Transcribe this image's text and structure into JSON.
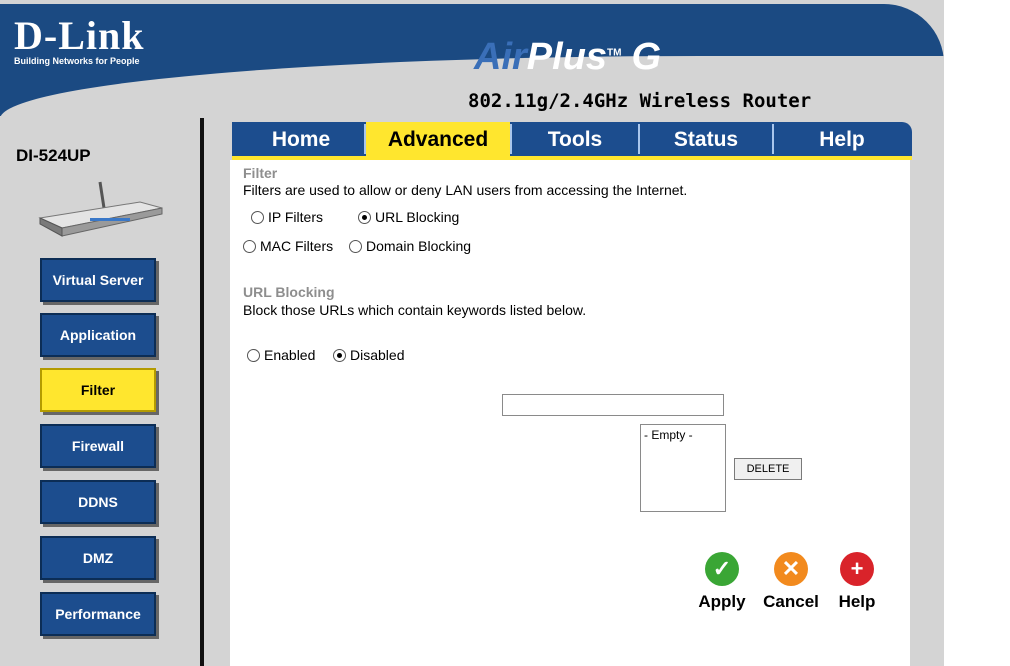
{
  "brand": {
    "logo": "D-Link",
    "tagline": "Building Networks for People",
    "product_air": "Air",
    "product_plus": "Plus",
    "product_g": "G",
    "product_tm": "TM",
    "product_line": "802.11g/2.4GHz Wireless Router"
  },
  "model": "DI-524UP",
  "tabs": [
    {
      "label": "Home",
      "active": false
    },
    {
      "label": "Advanced",
      "active": true
    },
    {
      "label": "Tools",
      "active": false
    },
    {
      "label": "Status",
      "active": false
    },
    {
      "label": "Help",
      "active": false
    }
  ],
  "sidebar": [
    {
      "label": "Virtual Server",
      "active": false
    },
    {
      "label": "Application",
      "active": false
    },
    {
      "label": "Filter",
      "active": true
    },
    {
      "label": "Firewall",
      "active": false
    },
    {
      "label": "DDNS",
      "active": false
    },
    {
      "label": "DMZ",
      "active": false
    },
    {
      "label": "Performance",
      "active": false
    }
  ],
  "filter": {
    "title": "Filter",
    "description": "Filters are used to allow or deny LAN users from accessing the Internet.",
    "options": [
      {
        "label": "IP Filters",
        "selected": false
      },
      {
        "label": "URL Blocking",
        "selected": true
      },
      {
        "label": "MAC Filters",
        "selected": false
      },
      {
        "label": "Domain Blocking",
        "selected": false
      }
    ]
  },
  "url_blocking": {
    "title": "URL Blocking",
    "description": "Block those URLs which contain keywords listed below.",
    "enabled_label": "Enabled",
    "disabled_label": "Disabled",
    "selected": "Disabled",
    "keyword_value": "",
    "list_items": [
      "- Empty -"
    ],
    "delete_label": "DELETE"
  },
  "actions": {
    "apply": "Apply",
    "cancel": "Cancel",
    "help": "Help"
  },
  "colors": {
    "brand_blue": "#1c4d8e",
    "active_yellow": "#ffe62e",
    "apply_green": "#3aa635",
    "cancel_orange": "#f28a1e",
    "help_red": "#d9232a"
  }
}
